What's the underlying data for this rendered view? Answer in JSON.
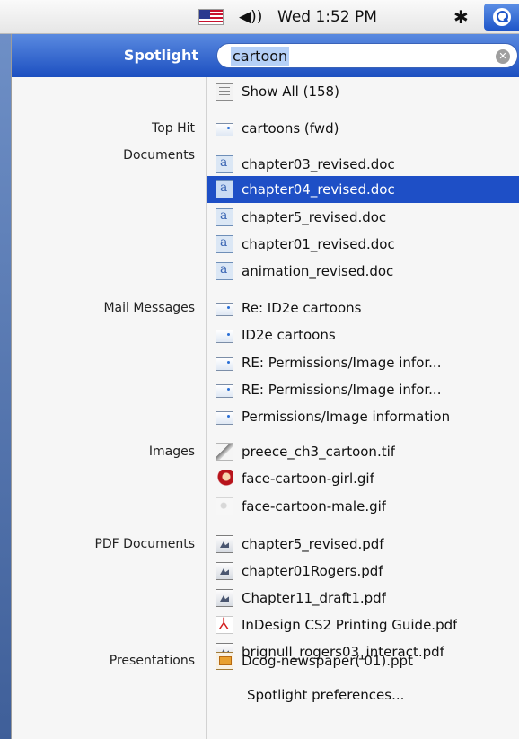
{
  "menubar": {
    "clock": "Wed 1:52 PM",
    "volume_glyph": "◀︎))",
    "bluetooth_glyph": "✱",
    "icons": [
      "flag-icon",
      "volume-icon",
      "bluetooth-icon",
      "spotlight-icon"
    ]
  },
  "spotlight": {
    "title": "Spotlight",
    "query": "cartoon",
    "clear_glyph": "✕",
    "accent": "#1e4fc6"
  },
  "categories": [
    {
      "name": "top-hit",
      "label": "Top Hit"
    },
    {
      "name": "documents",
      "label": "Documents"
    },
    {
      "name": "mail-messages",
      "label": "Mail Messages"
    },
    {
      "name": "images",
      "label": "Images"
    },
    {
      "name": "pdf-documents",
      "label": "PDF Documents"
    },
    {
      "name": "presentations",
      "label": "Presentations"
    }
  ],
  "results": [
    {
      "label": "Show All (158)",
      "icon": "show-all-icon"
    },
    {
      "label": "cartoons (fwd)",
      "icon": "mail-icon"
    },
    {
      "label": "chapter03_revised.doc",
      "icon": "word-doc-icon"
    },
    {
      "label": "chapter04_revised.doc",
      "icon": "word-doc-icon",
      "selected": true
    },
    {
      "label": "chapter5_revised.doc",
      "icon": "word-doc-icon"
    },
    {
      "label": "chapter01_revised.doc",
      "icon": "word-doc-icon"
    },
    {
      "label": "animation_revised.doc",
      "icon": "word-doc-icon"
    },
    {
      "label": "Re: ID2e cartoons",
      "icon": "mail-icon"
    },
    {
      "label": "ID2e cartoons",
      "icon": "mail-icon"
    },
    {
      "label": "RE: Permissions/Image infor...",
      "icon": "mail-icon"
    },
    {
      "label": "RE: Permissions/Image infor...",
      "icon": "mail-icon"
    },
    {
      "label": "Permissions/Image information",
      "icon": "mail-icon"
    },
    {
      "label": "preece_ch3_cartoon.tif",
      "icon": "tif-image-icon"
    },
    {
      "label": "face-cartoon-girl.gif",
      "icon": "gif-image-icon"
    },
    {
      "label": "face-cartoon-male.gif",
      "icon": "gif-image-icon"
    },
    {
      "label": "chapter5_revised.pdf",
      "icon": "pdf-icon"
    },
    {
      "label": "chapter01Rogers.pdf",
      "icon": "pdf-icon"
    },
    {
      "label": "Chapter11_draft1.pdf",
      "icon": "pdf-icon"
    },
    {
      "label": "InDesign CS2 Printing Guide.pdf",
      "icon": "acrobat-pdf-icon"
    },
    {
      "label": "brignull_rogers03_interact.pdf",
      "icon": "pdf-icon"
    },
    {
      "label": "Dcog-newspaper('01).ppt",
      "icon": "powerpoint-icon"
    }
  ],
  "preferences_label": "Spotlight preferences..."
}
